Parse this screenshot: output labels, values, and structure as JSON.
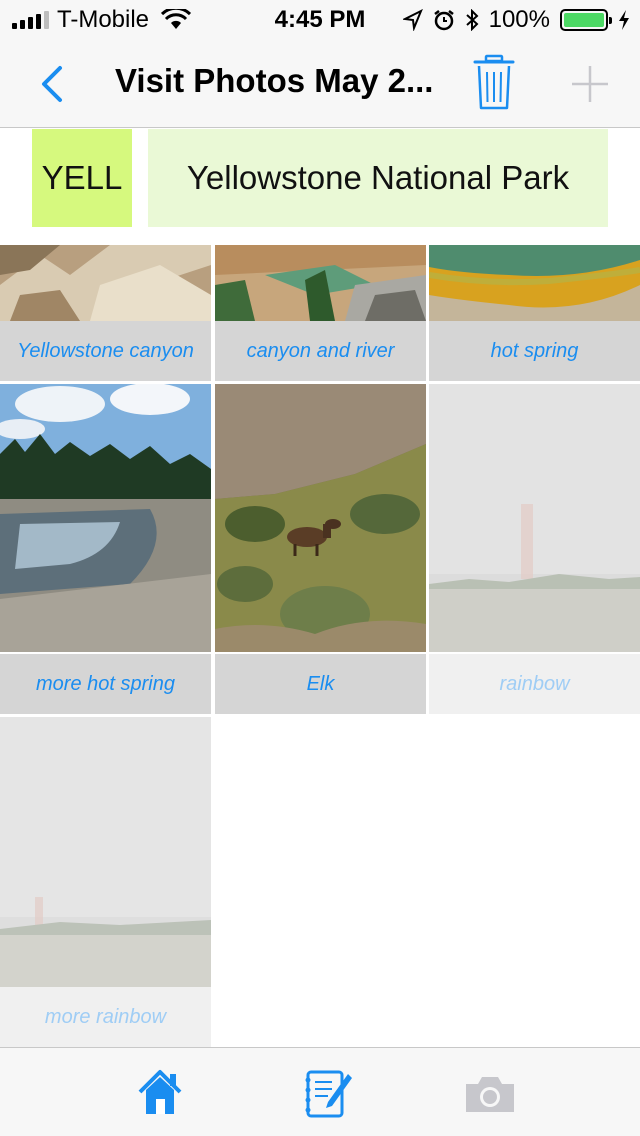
{
  "status_bar": {
    "carrier": "T-Mobile",
    "time": "4:45 PM",
    "battery": "100%"
  },
  "nav": {
    "title": "Visit Photos May 2..."
  },
  "park": {
    "code": "YELL",
    "name": "Yellowstone National Park"
  },
  "photos": [
    {
      "caption": "Yellowstone canyon"
    },
    {
      "caption": "canyon and river"
    },
    {
      "caption": "hot spring"
    },
    {
      "caption": "more hot spring"
    },
    {
      "caption": "Elk"
    },
    {
      "caption": "rainbow"
    },
    {
      "caption": "more rainbow"
    }
  ],
  "tabs": [
    {
      "icon": "home-icon",
      "active": true
    },
    {
      "icon": "notebook-icon",
      "active": false
    },
    {
      "icon": "camera-icon",
      "active": false
    }
  ],
  "colors": {
    "accent": "#1a8df0",
    "park_code_bg": "#d6f97e",
    "park_name_bg": "#eaf9d6",
    "caption_bg": "#d5d5d5"
  }
}
